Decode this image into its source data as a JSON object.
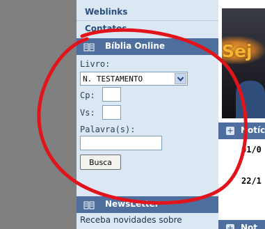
{
  "sidebar": {
    "nav_items": [
      {
        "label": "Weblinks"
      },
      {
        "label": "Contatos"
      }
    ],
    "bible_module": {
      "title": "Bíblia Online",
      "livro_label": "Livro:",
      "livro_selected": "N. TESTAMENTO",
      "cp_label": "Cp:",
      "vs_label": "Vs:",
      "palavra_label": "Palavra(s):",
      "search_button": "Busca"
    },
    "newsletter_module": {
      "title": "NewsLetter",
      "text": "Receba novidades sobre"
    }
  },
  "right_column": {
    "banner_text": "Sej",
    "news_heading": "Notíc",
    "news_dates": [
      "01/0",
      "22/1"
    ],
    "second_heading": "Not"
  },
  "colors": {
    "sidebar_bg": "#dbe8f4",
    "header_bg": "#4e6f9d",
    "link_color": "#2a4f7d",
    "annotation_red": "#e0141a"
  },
  "icons": {
    "module_icon": "book-icon",
    "news_icon": "plus-square-icon",
    "select_icon": "chevron-down-icon"
  }
}
